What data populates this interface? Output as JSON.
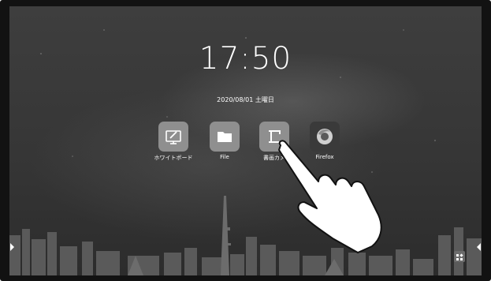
{
  "clock": {
    "time": "17:50",
    "date": "2020/08/01 土曜日"
  },
  "apps": [
    {
      "label": "ホワイトボード",
      "icon": "whiteboard-icon"
    },
    {
      "label": "File",
      "icon": "folder-icon"
    },
    {
      "label": "書画カメ",
      "icon": "document-camera-icon"
    },
    {
      "label": "Firefox",
      "icon": "firefox-icon"
    }
  ],
  "controls": {
    "left_edge": "chevron-right-icon",
    "right_edge": "chevron-left-icon",
    "widget": "widget-grid-icon"
  },
  "overlay": {
    "icon": "pointing-hand-icon"
  },
  "colors": {
    "bezel": "#121212",
    "tile": "#8f8f8f",
    "text": "#ffffff"
  }
}
